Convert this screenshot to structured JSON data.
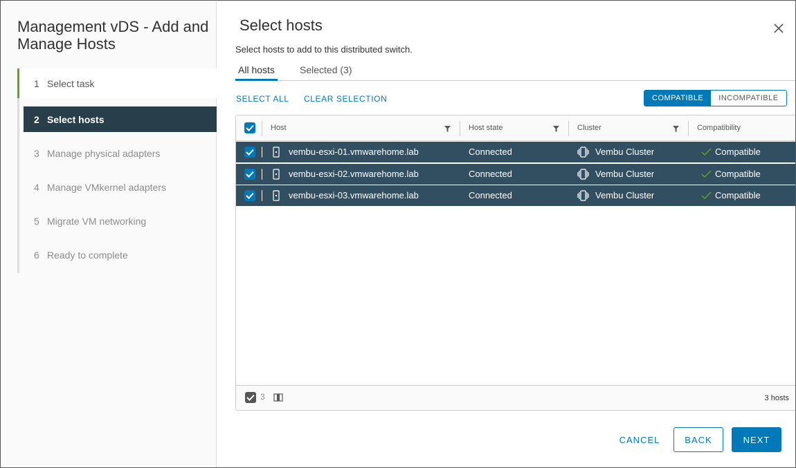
{
  "wizard": {
    "title": "Management vDS - Add and Manage Hosts",
    "steps": [
      {
        "num": "1",
        "label": "Select task"
      },
      {
        "num": "2",
        "label": "Select hosts"
      },
      {
        "num": "3",
        "label": "Manage physical adapters"
      },
      {
        "num": "4",
        "label": "Manage VMkernel adapters"
      },
      {
        "num": "5",
        "label": "Migrate VM networking"
      },
      {
        "num": "6",
        "label": "Ready to complete"
      }
    ]
  },
  "page": {
    "title": "Select hosts",
    "subtitle": "Select hosts to add to this distributed switch."
  },
  "tabs": [
    {
      "label": "All hosts"
    },
    {
      "label": "Selected (3)"
    }
  ],
  "actions": {
    "select_all": "SELECT ALL",
    "clear_selection": "CLEAR SELECTION"
  },
  "filter_toggle": {
    "compatible": "COMPATIBLE",
    "incompatible": "INCOMPATIBLE",
    "selected": "COMPATIBLE"
  },
  "grid": {
    "columns": [
      "Host",
      "Host state",
      "Cluster",
      "Compatibility"
    ],
    "rows": [
      {
        "host": "vembu-esxi-01.vmwarehome.lab",
        "state": "Connected",
        "cluster": "Vembu Cluster",
        "compat": "Compatible"
      },
      {
        "host": "vembu-esxi-02.vmwarehome.lab",
        "state": "Connected",
        "cluster": "Vembu Cluster",
        "compat": "Compatible"
      },
      {
        "host": "vembu-esxi-03.vmwarehome.lab",
        "state": "Connected",
        "cluster": "Vembu Cluster",
        "compat": "Compatible"
      }
    ],
    "footer": {
      "selected_count": "3",
      "total": "3 hosts"
    }
  },
  "buttons": {
    "cancel": "CANCEL",
    "back": "BACK",
    "next": "NEXT"
  },
  "colors": {
    "accent": "#0079b8",
    "selected_row": "#324f61",
    "active_step": "#283f4b",
    "done_step": "#62a420",
    "ok_check": "#62a420"
  },
  "icons": {
    "close": "close-icon",
    "filter": "filter-icon",
    "host": "host-icon",
    "cluster": "cluster-icon",
    "compatible": "check-icon",
    "columns": "columns-icon"
  }
}
